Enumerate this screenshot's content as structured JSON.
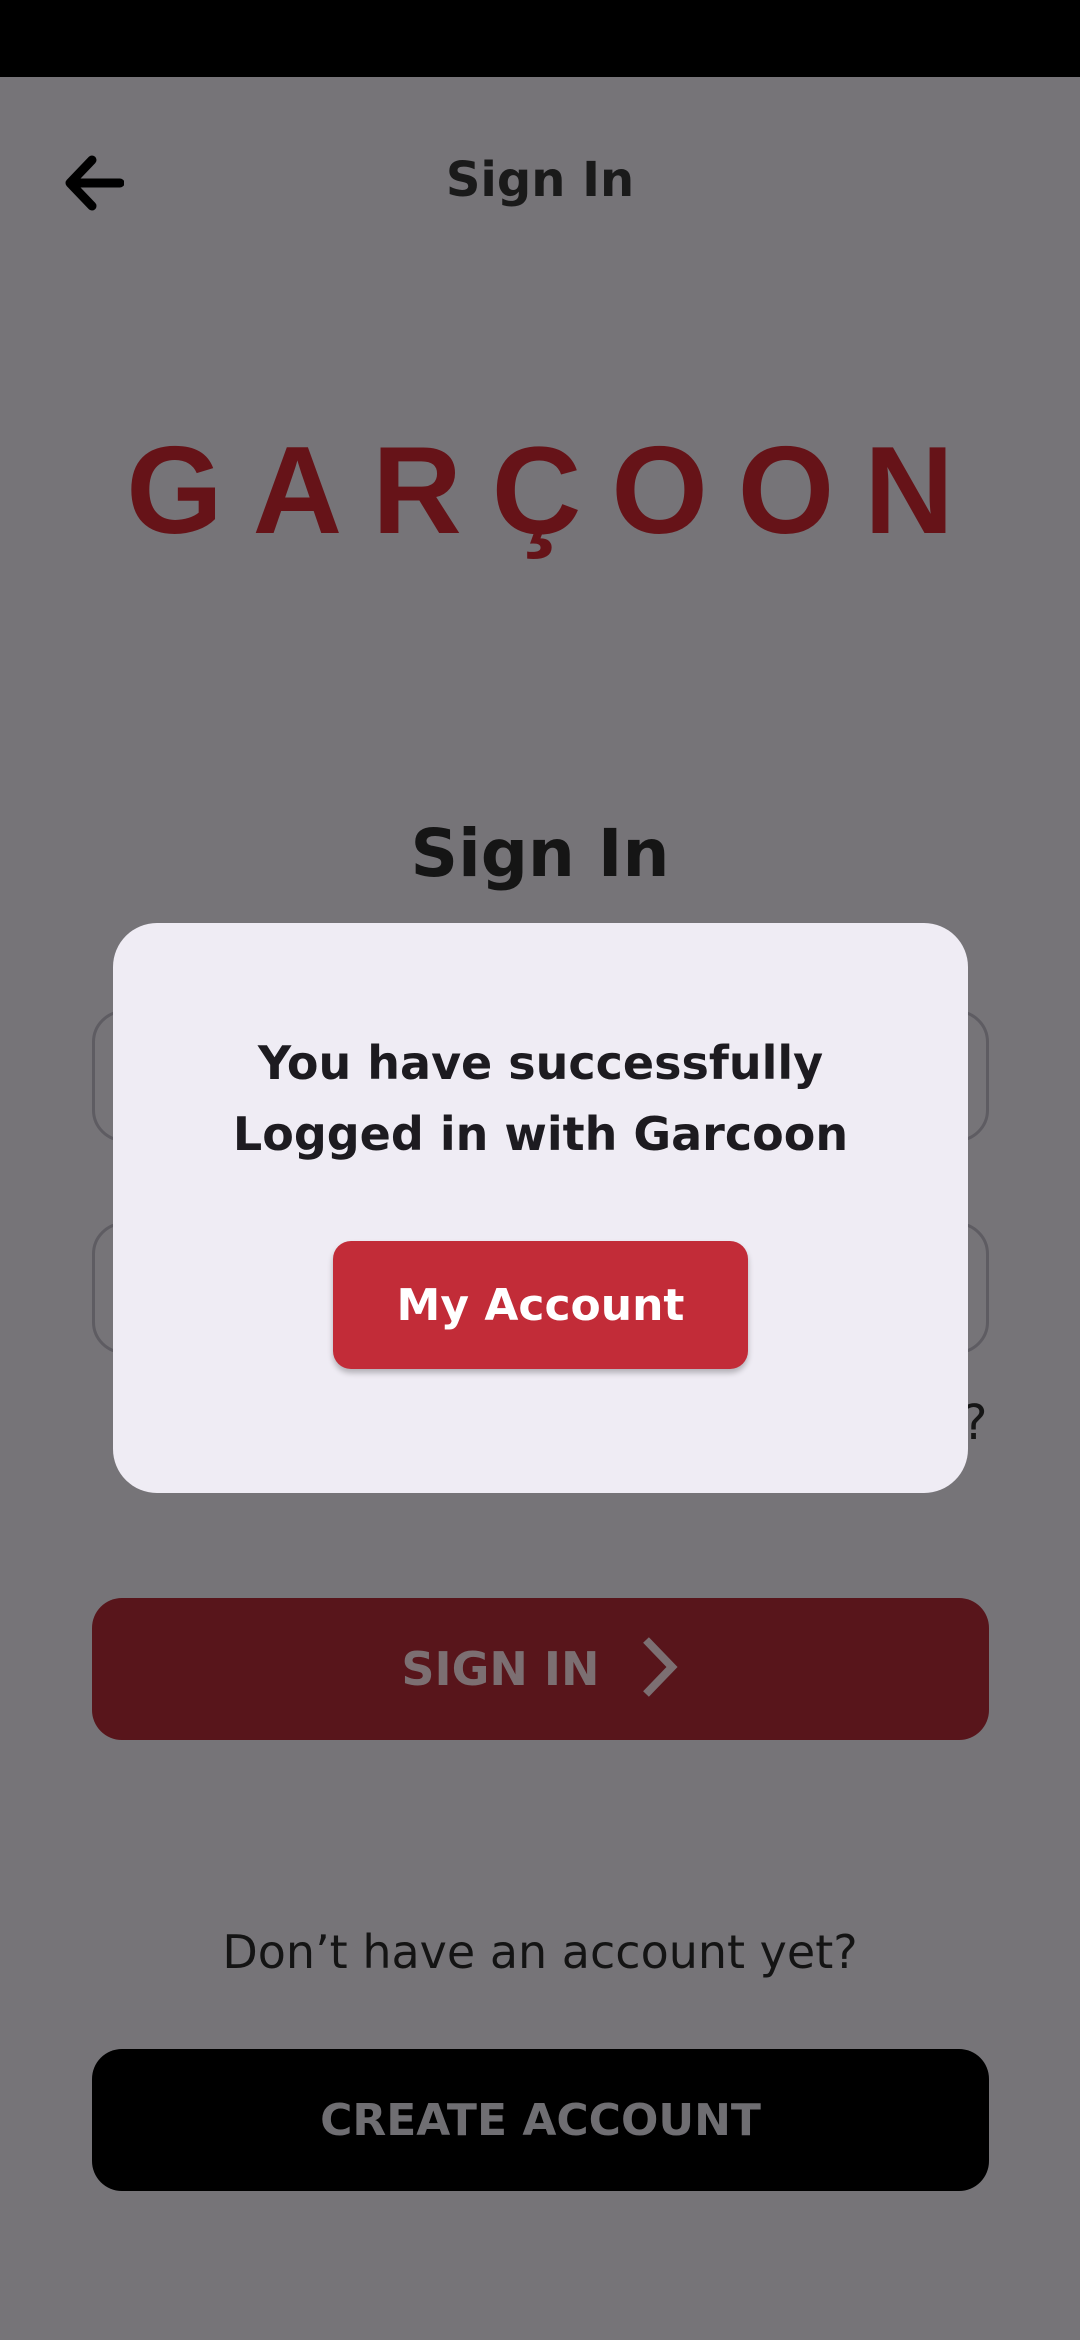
{
  "header": {
    "title": "Sign In",
    "back_icon": "arrow-left-icon"
  },
  "brand": {
    "logo_text": "GARÇOON",
    "logo_color": "#661318"
  },
  "form": {
    "section_title": "Sign In",
    "forgot_partial": "?",
    "signin_label": "SIGN IN",
    "signin_icon": "chevron-right-icon"
  },
  "footer": {
    "no_account_text": "Don’t have an account yet?",
    "create_label": "CREATE ACCOUNT"
  },
  "dialog": {
    "message_line1": "You have successfully",
    "message_line2": "Logged in with Garcoon",
    "button_label": "My Account",
    "button_color": "#c22c38"
  }
}
